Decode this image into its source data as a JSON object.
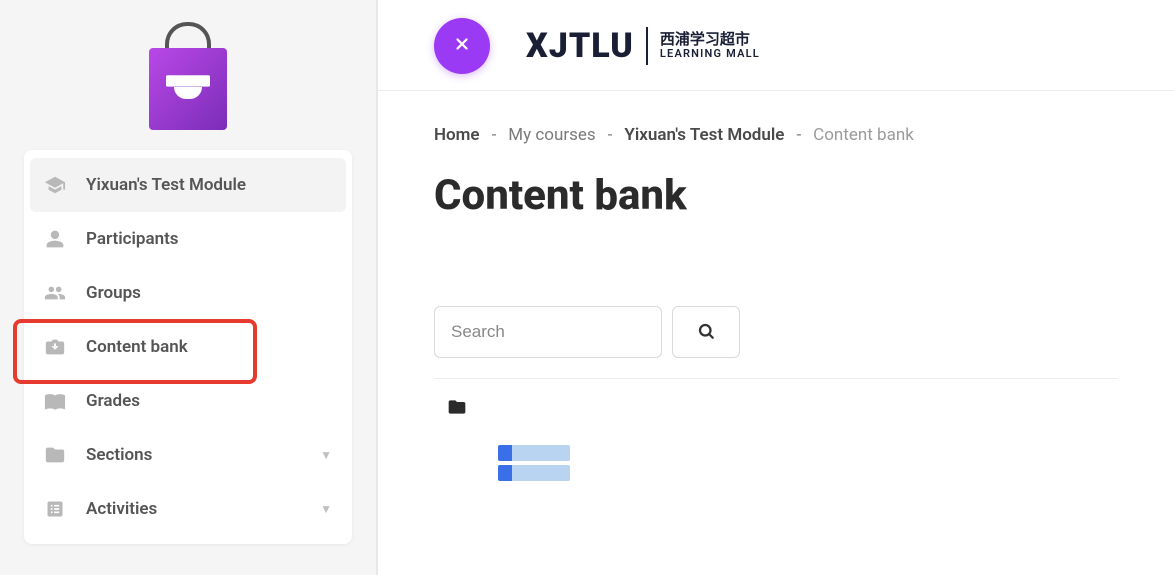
{
  "brand": {
    "main": "XJTLU",
    "cn": "西浦学习超市",
    "en": "LEARNING MALL"
  },
  "sidebar": {
    "items": [
      {
        "label": "Yixuan's Test Module",
        "icon": "graduation-cap-icon"
      },
      {
        "label": "Participants",
        "icon": "user-icon"
      },
      {
        "label": "Groups",
        "icon": "users-icon"
      },
      {
        "label": "Content bank",
        "icon": "box-icon"
      },
      {
        "label": "Grades",
        "icon": "book-icon"
      },
      {
        "label": "Sections",
        "icon": "folder-icon"
      },
      {
        "label": "Activities",
        "icon": "list-icon"
      }
    ]
  },
  "breadcrumb": {
    "home": "Home",
    "mycourses": "My courses",
    "module": "Yixuan's Test Module",
    "current": "Content bank",
    "sep": "-"
  },
  "page": {
    "title": "Content bank"
  },
  "search": {
    "placeholder": "Search"
  }
}
